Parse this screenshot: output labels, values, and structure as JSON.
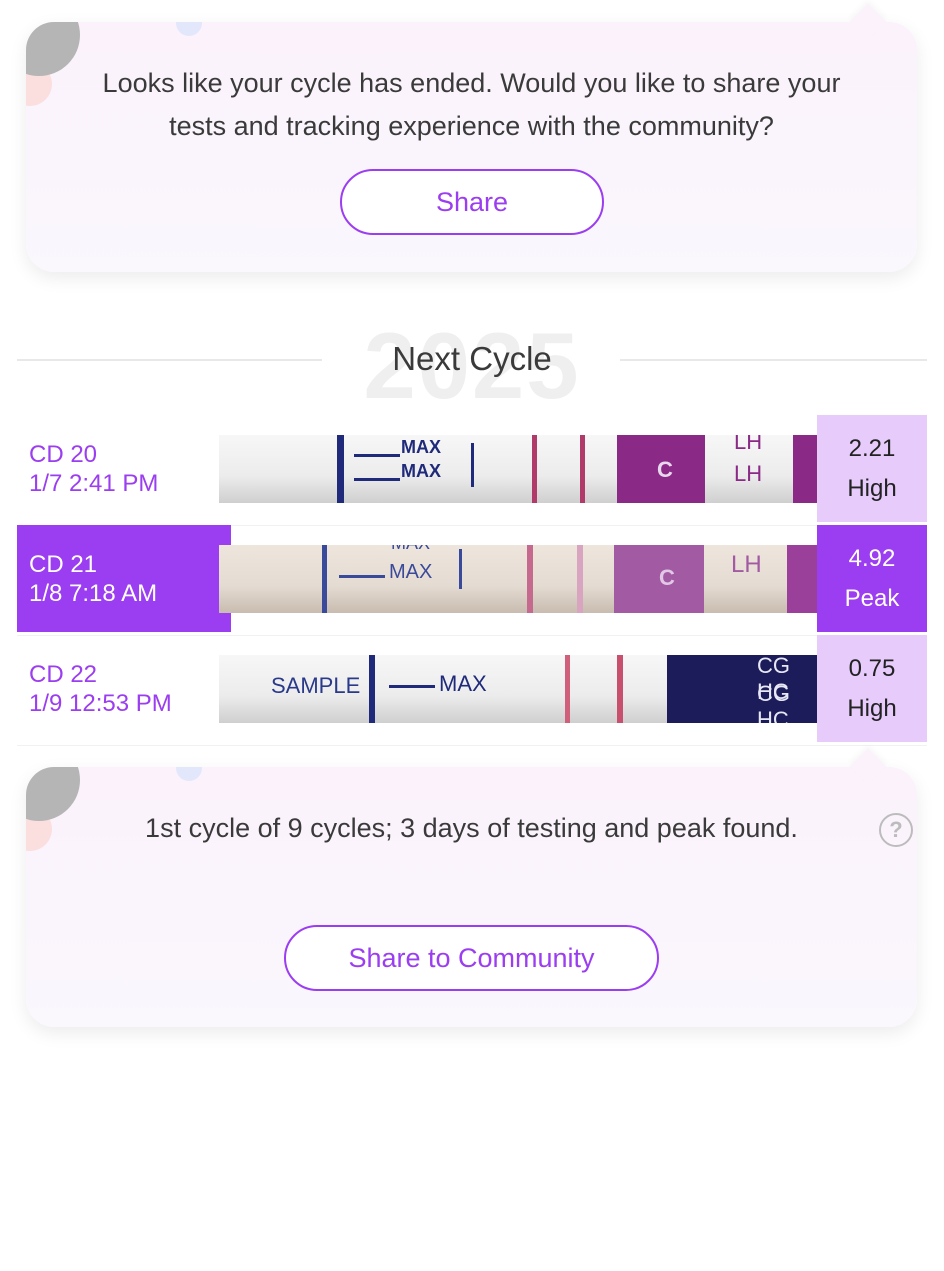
{
  "top_card": {
    "message": "Looks like your cycle has ended. Would you like to share your tests and tracking experience with the community?",
    "share_label": "Share"
  },
  "section": {
    "watermark_year": "2025",
    "title": "Next Cycle"
  },
  "tests": [
    {
      "cycle_day": "CD 20",
      "datetime": "1/7 2:41 PM",
      "value": "2.21",
      "status": "High",
      "selected": false
    },
    {
      "cycle_day": "CD 21",
      "datetime": "1/8 7:18 AM",
      "value": "4.92",
      "status": "Peak",
      "selected": true
    },
    {
      "cycle_day": "CD 22",
      "datetime": "1/9 12:53 PM",
      "value": "0.75",
      "status": "High",
      "selected": false
    }
  ],
  "strip_text": {
    "row0": {
      "max1": "MAX",
      "max2": "MAX",
      "lh1": "LH",
      "lh2": "LH",
      "c": "C"
    },
    "row1": {
      "max1": "MAX",
      "max2": "MAX",
      "lh1": "LH",
      "c": "C"
    },
    "row2": {
      "sample": "SAMPLE",
      "max": "MAX",
      "cg1": "CG HC",
      "cg2": "CG HC"
    }
  },
  "summary_card": {
    "message": "1st cycle of 9 cycles; 3 days of testing and peak found.",
    "help_glyph": "?",
    "share_label": "Share to Community"
  },
  "colors": {
    "accent": "#9b3df0",
    "result_bg": "#e6cbfb"
  },
  "icons": [
    "close-icon",
    "help-icon"
  ]
}
